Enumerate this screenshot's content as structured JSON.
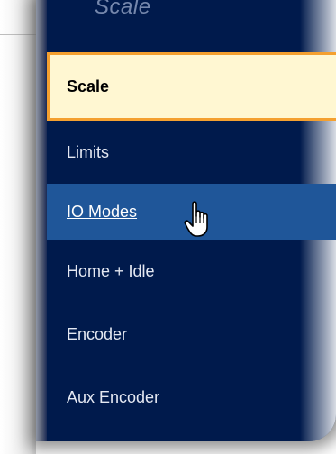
{
  "panel": {
    "title": "Scale"
  },
  "menu": {
    "items": [
      {
        "label": "Scale",
        "state": "selected"
      },
      {
        "label": "Limits",
        "state": "normal"
      },
      {
        "label": "IO Modes",
        "state": "hover"
      },
      {
        "label": "Home + Idle",
        "state": "normal"
      },
      {
        "label": "Encoder",
        "state": "normal"
      },
      {
        "label": "Aux Encoder",
        "state": "normal"
      }
    ]
  },
  "colors": {
    "panel_bg": "#001a4c",
    "selected_bg": "#fff7d2",
    "selected_border": "#f4a030",
    "hover_bg": "#1f5699",
    "text": "#e4e8f2"
  },
  "cursor": {
    "icon": "hand-pointer-icon"
  }
}
